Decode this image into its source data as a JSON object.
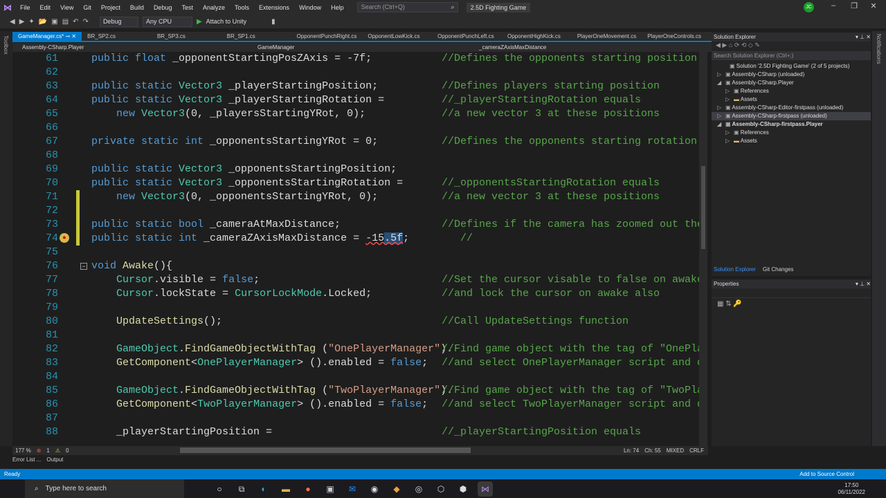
{
  "menu": [
    "File",
    "Edit",
    "View",
    "Git",
    "Project",
    "Build",
    "Debug",
    "Test",
    "Analyze",
    "Tools",
    "Extensions",
    "Window",
    "Help"
  ],
  "search_placeholder": "Search (Ctrl+Q)",
  "app_title": "2.5D Fighting Game",
  "user_initials": "JC",
  "toolbar": {
    "config": "Debug",
    "platform": "Any CPU",
    "attach": "Attach to Unity"
  },
  "left_strip": "Toolbox",
  "right_strip": "Notifications",
  "tabs": [
    "GameManager.cs*",
    "BR_SP2.cs",
    "BR_SP3.cs",
    "BR_SP1.cs",
    "OpponentPunchRight.cs",
    "OpponentLowKick.cs",
    "OpponentPunchLeft.cs",
    "OpponentHighKick.cs",
    "PlayerOneMovement.cs",
    "PlayerOneControls.cs"
  ],
  "nav": {
    "project": "Assembly-CSharp.Player",
    "class": "GameManager",
    "member": "_cameraZAxisMaxDistance"
  },
  "code": [
    {
      "n": "61",
      "c": [
        [
          "k",
          "public float "
        ],
        [
          "p",
          "_opponentStartingPosZAxis = -7f;"
        ]
      ],
      "cm": "//Defines the opponents starting position on"
    },
    {
      "n": "62",
      "c": []
    },
    {
      "n": "63",
      "c": [
        [
          "k",
          "public static "
        ],
        [
          "t",
          "Vector3"
        ],
        [
          "p",
          " _playerStartingPosition;"
        ]
      ],
      "cm": "//Defines players starting position"
    },
    {
      "n": "64",
      "c": [
        [
          "k",
          "public static "
        ],
        [
          "t",
          "Vector3"
        ],
        [
          "p",
          " _playerStartingRotation ="
        ]
      ],
      "cm": "//_playerStartingRotation equals"
    },
    {
      "n": "65",
      "c": [
        [
          "p",
          "    "
        ],
        [
          "k",
          "new "
        ],
        [
          "t",
          "Vector3"
        ],
        [
          "p",
          "(0, _playersStartingYRot, 0);"
        ]
      ],
      "cm": "//a new vector 3 at these positions"
    },
    {
      "n": "66",
      "c": []
    },
    {
      "n": "67",
      "c": [
        [
          "k",
          "private static int "
        ],
        [
          "p",
          "_opponentsStartingYRot = 0;"
        ]
      ],
      "cm": "//Defines the opponents starting rotation"
    },
    {
      "n": "68",
      "c": []
    },
    {
      "n": "69",
      "c": [
        [
          "k",
          "public static "
        ],
        [
          "t",
          "Vector3"
        ],
        [
          "p",
          " _opponentsStartingPosition;"
        ]
      ]
    },
    {
      "n": "70",
      "c": [
        [
          "k",
          "public static "
        ],
        [
          "t",
          "Vector3"
        ],
        [
          "p",
          " _opponentsStartingRotation ="
        ]
      ],
      "cm": "//_opponentsStartingRotation equals"
    },
    {
      "n": "71",
      "c": [
        [
          "p",
          "    "
        ],
        [
          "k",
          "new "
        ],
        [
          "t",
          "Vector3"
        ],
        [
          "p",
          "(0, _opponentsStartingYRot, 0);"
        ]
      ],
      "cm": "//a new vector 3 at these positions"
    },
    {
      "n": "72",
      "c": []
    },
    {
      "n": "73",
      "c": [
        [
          "k",
          "public static bool "
        ],
        [
          "p",
          "_cameraAtMaxDistance;"
        ]
      ],
      "cm": "//Defines if the camera has zoomed out the t"
    },
    {
      "n": "74",
      "c": [
        [
          "k",
          "public static int "
        ],
        [
          "p",
          "_cameraZAxisMaxDistance = "
        ],
        [
          "p err",
          "-15"
        ],
        [
          "p err sel",
          ".5f"
        ],
        [
          "p",
          ";"
        ]
      ],
      "cm": "   //"
    },
    {
      "n": "75",
      "c": []
    },
    {
      "n": "76",
      "c": [
        [
          "k",
          "void "
        ],
        [
          "m",
          "Awake"
        ],
        [
          "p",
          "(){"
        ]
      ]
    },
    {
      "n": "77",
      "c": [
        [
          "p",
          "    "
        ],
        [
          "t",
          "Cursor"
        ],
        [
          "p",
          ".visible = "
        ],
        [
          "k",
          "false"
        ],
        [
          "p",
          ";"
        ]
      ],
      "cm": "//Set the cursor visable to false on awake"
    },
    {
      "n": "78",
      "c": [
        [
          "p",
          "    "
        ],
        [
          "t",
          "Cursor"
        ],
        [
          "p",
          ".lockState = "
        ],
        [
          "t",
          "CursorLockMode"
        ],
        [
          "p",
          ".Locked;"
        ]
      ],
      "cm": "//and lock the cursor on awake also"
    },
    {
      "n": "79",
      "c": []
    },
    {
      "n": "80",
      "c": [
        [
          "p",
          "    "
        ],
        [
          "m",
          "UpdateSettings"
        ],
        [
          "p",
          "();"
        ]
      ],
      "cm": "//Call UpdateSettings function"
    },
    {
      "n": "81",
      "c": []
    },
    {
      "n": "82",
      "c": [
        [
          "p",
          "    "
        ],
        [
          "t",
          "GameObject"
        ],
        [
          "p",
          "."
        ],
        [
          "m",
          "FindGameObjectWithTag"
        ],
        [
          "p",
          " ("
        ],
        [
          "s",
          "\"OnePlayerManager\""
        ],
        [
          "p",
          ")."
        ]
      ],
      "cm": "//Find game object with the tag of \"OnePlaye"
    },
    {
      "n": "83",
      "c": [
        [
          "p",
          "    "
        ],
        [
          "m",
          "GetComponent"
        ],
        [
          "p",
          "<"
        ],
        [
          "t",
          "OnePlayerManager"
        ],
        [
          "p",
          "> ().enabled = "
        ],
        [
          "k",
          "false"
        ],
        [
          "p",
          ";"
        ]
      ],
      "cm": "//and select OnePlayerManager script and dis"
    },
    {
      "n": "84",
      "c": []
    },
    {
      "n": "85",
      "c": [
        [
          "p",
          "    "
        ],
        [
          "t",
          "GameObject"
        ],
        [
          "p",
          "."
        ],
        [
          "m",
          "FindGameObjectWithTag"
        ],
        [
          "p",
          " ("
        ],
        [
          "s",
          "\"TwoPlayerManager\""
        ],
        [
          "p",
          ")."
        ]
      ],
      "cm": "//Find game object with the tag of \"TwoPlaye"
    },
    {
      "n": "86",
      "c": [
        [
          "p",
          "    "
        ],
        [
          "m",
          "GetComponent"
        ],
        [
          "p",
          "<"
        ],
        [
          "t",
          "TwoPlayerManager"
        ],
        [
          "p",
          "> ().enabled = "
        ],
        [
          "k",
          "false"
        ],
        [
          "p",
          ";"
        ]
      ],
      "cm": "//and select TwoPlayerManager script and dis"
    },
    {
      "n": "87",
      "c": []
    },
    {
      "n": "88",
      "c": [
        [
          "p",
          "    _playerStartingPosition ="
        ]
      ],
      "cm": "//_playerStartingPosition equals"
    }
  ],
  "editor_status": {
    "zoom": "177 %",
    "errors": "1",
    "warnings": "0",
    "line": "Ln: 74",
    "col": "Ch: 55",
    "encoding": "MIXED",
    "eol": "CRLF"
  },
  "bottom_tabs": [
    "Error List ...",
    "Output"
  ],
  "solution_explorer": {
    "title": "Solution Explorer",
    "search_placeholder": "Search Solution Explorer (Ctrl+;)",
    "items": [
      {
        "label": "Solution '2.5D Fighting Game' (2 of 5 projects)",
        "level": 0,
        "arrow": ""
      },
      {
        "label": "Assembly-CSharp (unloaded)",
        "level": 1,
        "arrow": "▷"
      },
      {
        "label": "Assembly-CSharp.Player",
        "level": 1,
        "arrow": "◢"
      },
      {
        "label": "References",
        "level": 2,
        "arrow": "▷"
      },
      {
        "label": "Assets",
        "level": 2,
        "arrow": "▷"
      },
      {
        "label": "Assembly-CSharp-Editor-firstpass (unloaded)",
        "level": 1,
        "arrow": "▷"
      },
      {
        "label": "Assembly-CSharp-firstpass (unloaded)",
        "level": 1,
        "arrow": "▷"
      },
      {
        "label": "Assembly-CSharp-firstpass.Player",
        "level": 1,
        "arrow": "◢"
      },
      {
        "label": "References",
        "level": 2,
        "arrow": "▷"
      },
      {
        "label": "Assets",
        "level": 2,
        "arrow": "▷"
      }
    ],
    "tabs": [
      "Solution Explorer",
      "Git Changes"
    ]
  },
  "properties": {
    "title": "Properties"
  },
  "statusbar": {
    "ready": "Ready",
    "source_control": "Add to Source Control"
  },
  "taskbar": {
    "search": "Type here to search",
    "time": "17:50",
    "date": "06/11/2022"
  }
}
